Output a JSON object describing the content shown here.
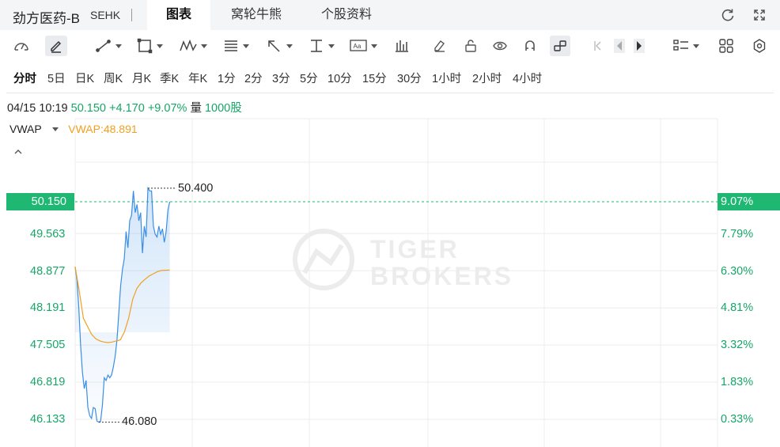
{
  "header": {
    "stock_name": "劲方医药-B",
    "exchange": "SEHK",
    "tabs": [
      {
        "label": "图表",
        "active": true
      },
      {
        "label": "窝轮牛熊",
        "active": false
      },
      {
        "label": "个股资料",
        "active": false
      }
    ],
    "icons": [
      "refresh-icon",
      "fullscreen-icon"
    ]
  },
  "toolbar": {
    "icons": [
      "gauge-icon",
      "pencil-edit-icon",
      "line-tool-icon",
      "rectangle-tool-icon",
      "pattern-tool-icon",
      "fibonacci-tool-icon",
      "arrow-tool-icon",
      "measure-tool-icon",
      "text-tool-icon",
      "bar-chart-tool-icon",
      "eraser-icon",
      "unlock-icon",
      "eye-icon",
      "magnet-icon",
      "link-icon",
      "undo-icon",
      "prev-icon",
      "next-icon",
      "layout-icon",
      "grid-icon",
      "settings-icon"
    ]
  },
  "periods": [
    {
      "label": "分时",
      "active": true
    },
    {
      "label": "5日"
    },
    {
      "label": "日K"
    },
    {
      "label": "周K"
    },
    {
      "label": "月K"
    },
    {
      "label": "季K"
    },
    {
      "label": "年K"
    },
    {
      "label": "1分"
    },
    {
      "label": "2分"
    },
    {
      "label": "3分"
    },
    {
      "label": "5分"
    },
    {
      "label": "10分"
    },
    {
      "label": "15分"
    },
    {
      "label": "30分"
    },
    {
      "label": "1小时"
    },
    {
      "label": "2小时"
    },
    {
      "label": "4小时"
    }
  ],
  "quote": {
    "datetime": "04/15 10:19",
    "price": "50.150",
    "change": "+4.170",
    "change_pct": "+9.07%",
    "volume_label": "量",
    "volume": "1000股"
  },
  "indicator": {
    "name": "VWAP",
    "value_text": "VWAP:48.891"
  },
  "watermark": {
    "line1": "TIGER",
    "line2": "BROKERS"
  },
  "chart_data": {
    "type": "line",
    "y_ticks": [
      "50.150",
      "49.563",
      "48.877",
      "48.191",
      "47.505",
      "46.819",
      "46.133"
    ],
    "pct_ticks": [
      "9.07%",
      "7.79%",
      "6.30%",
      "4.81%",
      "3.32%",
      "1.83%",
      "0.33%"
    ],
    "ylim": [
      46.133,
      50.15
    ],
    "current_price": "50.150",
    "current_pct": "9.07%",
    "high_label": "50.400",
    "low_label": "46.080",
    "series": [
      {
        "color": "#3a8ee6",
        "values": [
          48.95,
          48.7,
          48.2,
          47.5,
          47.0,
          46.7,
          46.85,
          46.35,
          46.2,
          46.15,
          46.35,
          46.33,
          46.1,
          46.08,
          46.1,
          46.4,
          46.9,
          46.85,
          46.95,
          46.9,
          46.95,
          47.1,
          47.3,
          47.6,
          48.1,
          48.6,
          48.9,
          49.1,
          49.6,
          49.3,
          49.8,
          49.9,
          50.35,
          49.95,
          50.1,
          49.8,
          49.95,
          49.2,
          49.7,
          49.5,
          50.4,
          50.35,
          50.35,
          49.7,
          49.55,
          49.5,
          49.7,
          49.55,
          49.65,
          49.4,
          49.6,
          50.0,
          50.15
        ]
      },
      {
        "color": "#f0a020",
        "values": [
          48.95,
          48.5,
          48.0,
          47.85,
          47.7,
          47.62,
          47.58,
          47.56,
          47.55,
          47.56,
          47.58,
          47.6,
          47.75,
          48.0,
          48.35,
          48.55,
          48.65,
          48.72,
          48.78,
          48.82,
          48.86,
          48.88,
          48.885,
          48.89
        ]
      }
    ]
  }
}
